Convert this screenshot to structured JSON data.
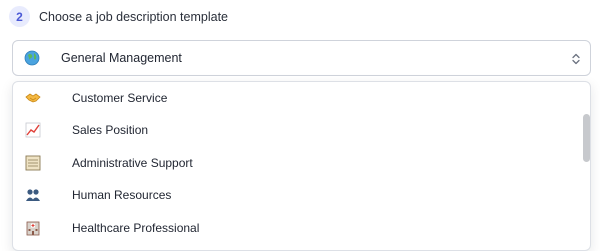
{
  "step": {
    "number": "2",
    "title": "Choose a job description template"
  },
  "select": {
    "value": "General Management",
    "icon": "globe-icon"
  },
  "options": [
    {
      "label": "Customer Service",
      "icon": "handshake-icon"
    },
    {
      "label": "Sales Position",
      "icon": "chart-increasing-icon"
    },
    {
      "label": "Administrative Support",
      "icon": "ledger-icon"
    },
    {
      "label": "Human Resources",
      "icon": "people-icon"
    },
    {
      "label": "Healthcare Professional",
      "icon": "hospital-icon"
    }
  ],
  "colors": {
    "accent": "#4a58d6",
    "accent_bg": "#e8ebfd",
    "border": "#cfd3db"
  }
}
